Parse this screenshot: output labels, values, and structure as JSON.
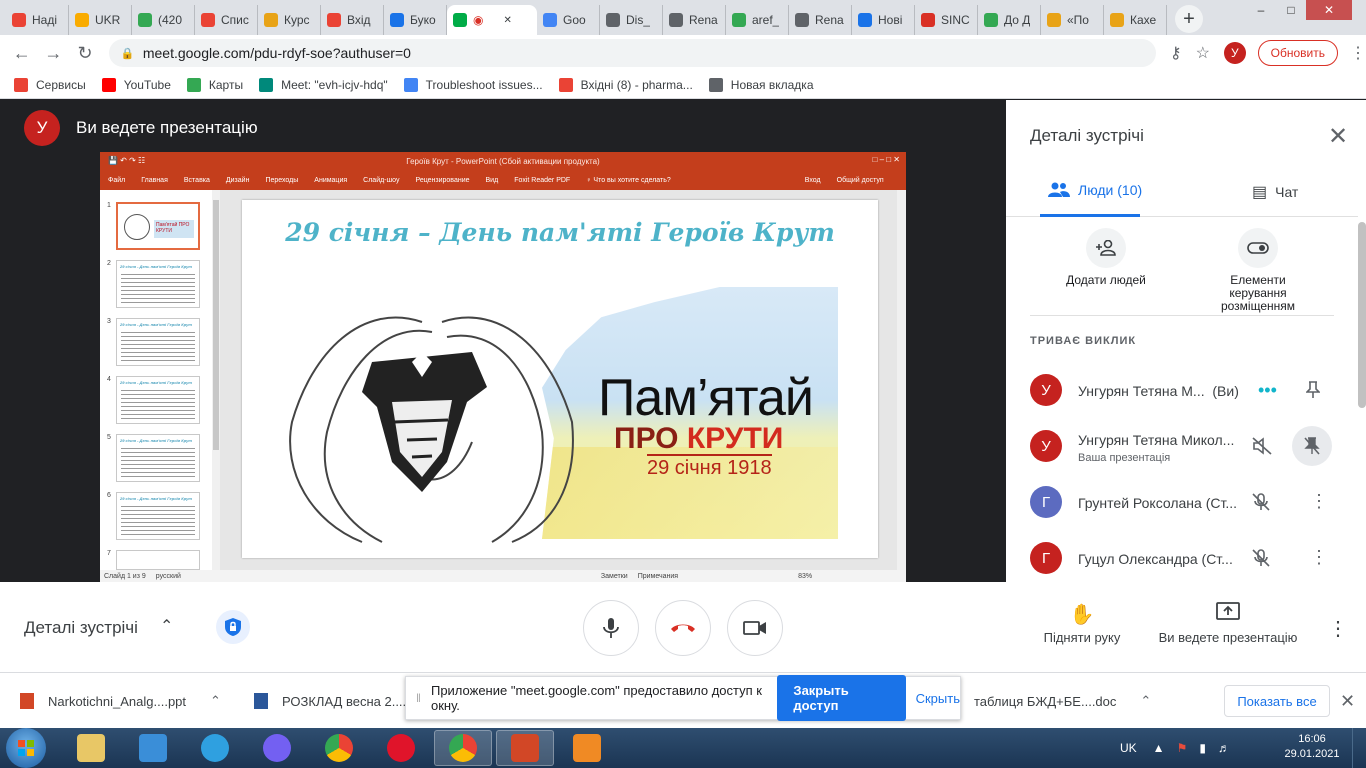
{
  "browser": {
    "tabs": [
      {
        "label": "Наді",
        "color": "#ea4335"
      },
      {
        "label": "UKR",
        "color": "#f9ab00"
      },
      {
        "label": "(420",
        "color": "#34a853"
      },
      {
        "label": "Спис",
        "color": "#ea4335"
      },
      {
        "label": "Курс",
        "color": "#e8a317"
      },
      {
        "label": "Вхід",
        "color": "#ea4335"
      },
      {
        "label": "Буко",
        "color": "#1a73e8"
      },
      {
        "label": "",
        "color": "#00ac47",
        "active": true
      },
      {
        "label": "Goo",
        "color": "#4285f4"
      },
      {
        "label": "Dis_",
        "color": "#5f6368"
      },
      {
        "label": "Rena",
        "color": "#5f6368"
      },
      {
        "label": "aref_",
        "color": "#34a853"
      },
      {
        "label": "Rena",
        "color": "#5f6368"
      },
      {
        "label": "Нові",
        "color": "#1a73e8"
      },
      {
        "label": "SINC",
        "color": "#d93025"
      },
      {
        "label": "До Д",
        "color": "#34a853"
      },
      {
        "label": "«По",
        "color": "#e8a317"
      },
      {
        "label": "Кахе",
        "color": "#e8a317"
      }
    ],
    "new_tab": "+",
    "url": "meet.google.com/pdu-rdyf-soe?authuser=0",
    "profile_initial": "У",
    "update_label": "Обновить",
    "bookmarks": [
      {
        "label": "Сервисы",
        "color": "#ea4335"
      },
      {
        "label": "YouTube",
        "color": "#ff0000"
      },
      {
        "label": "Карты",
        "color": "#34a853"
      },
      {
        "label": "Meet: \"evh-icjv-hdq\"",
        "color": "#00897b"
      },
      {
        "label": "Troubleshoot issues...",
        "color": "#4285f4"
      },
      {
        "label": "Вхідні (8) - pharma...",
        "color": "#ea4335"
      },
      {
        "label": "Новая вкладка",
        "color": "#5f6368"
      }
    ]
  },
  "meet": {
    "presenter_initial": "У",
    "presenting_title": "Ви ведете презентацію",
    "ppt": {
      "window_title": "Героїв Крут - PowerPoint (Сбой активации продукта)",
      "ribbon": [
        "Файл",
        "Главная",
        "Вставка",
        "Дизайн",
        "Переходы",
        "Анимация",
        "Слайд-шоу",
        "Рецензирование",
        "Вид",
        "Foxit Reader PDF",
        "♀ Что вы хотите сделать?"
      ],
      "ribbon_right": [
        "Вход",
        "Общий доступ"
      ],
      "thumbs": [
        {
          "num": "1",
          "title": ""
        },
        {
          "num": "2",
          "title": "29 січня - День пам'яті Героїв Крут"
        },
        {
          "num": "3",
          "title": "29 січня - День пам'яті Героїв Крут"
        },
        {
          "num": "4",
          "title": "29 січня - День пам'яті Героїв Крут"
        },
        {
          "num": "5",
          "title": "29 січня - День пам'яті Героїв Крут"
        },
        {
          "num": "6",
          "title": "29 січня - День пам'яті Героїв Крут"
        },
        {
          "num": "7",
          "title": ""
        }
      ],
      "thumb1_text": "Пам'ятай ПРО КРУТИ",
      "slide_title": "29 січня – День пам'яті  Героїв Крут",
      "slide_pam": "Пам’ятай",
      "slide_pro": "ПРО ",
      "slide_kruty": "КРУТИ",
      "slide_date": "29 січня 1918",
      "status_left": "Слайд 1 из 9",
      "status_lang": "русский",
      "status_notes": "Заметки",
      "status_comments": "Примечания",
      "status_zoom": "83%"
    }
  },
  "details": {
    "title": "Деталі зустрічі",
    "tab_people": "Люди (10)",
    "tab_chat": "Чат",
    "action_add": "Додати людей",
    "action_host": "Елементи керування розміщенням",
    "ongoing": "ТРИВАЄ ВИКЛИК",
    "people": [
      {
        "initial": "У",
        "name": "Унгурян Тетяна М...",
        "suffix": "(Ви)",
        "sub": "",
        "color": "#c5221f"
      },
      {
        "initial": "У",
        "name": "Унгурян Тетяна Микол...",
        "suffix": "",
        "sub": "Ваша презентація",
        "color": "#c5221f"
      },
      {
        "initial": "Г",
        "name": "Грунтей Роксолана (Ст...",
        "suffix": "",
        "sub": "",
        "color": "#5c6bc0"
      },
      {
        "initial": "Г",
        "name": "Гуцул Олександра (Ст...",
        "suffix": "",
        "sub": "",
        "color": "#c5221f"
      }
    ]
  },
  "controls": {
    "details_label": "Деталі зустрічі",
    "raise_hand": "Підняти руку",
    "presenting": "Ви ведете презентацію"
  },
  "downloads": {
    "items": [
      "Narkotichni_Analg....ppt",
      "РОЗКЛАД весна 2....d",
      "таблиця БЖД+БЕ....doc"
    ],
    "share_text": "Приложение \"meet.google.com\" предоставило доступ к окну.",
    "share_stop": "Закрыть доступ",
    "share_hide": "Скрыть",
    "show_all": "Показать все"
  },
  "taskbar": {
    "lang": "UK",
    "time": "16:06",
    "date": "29.01.2021"
  }
}
